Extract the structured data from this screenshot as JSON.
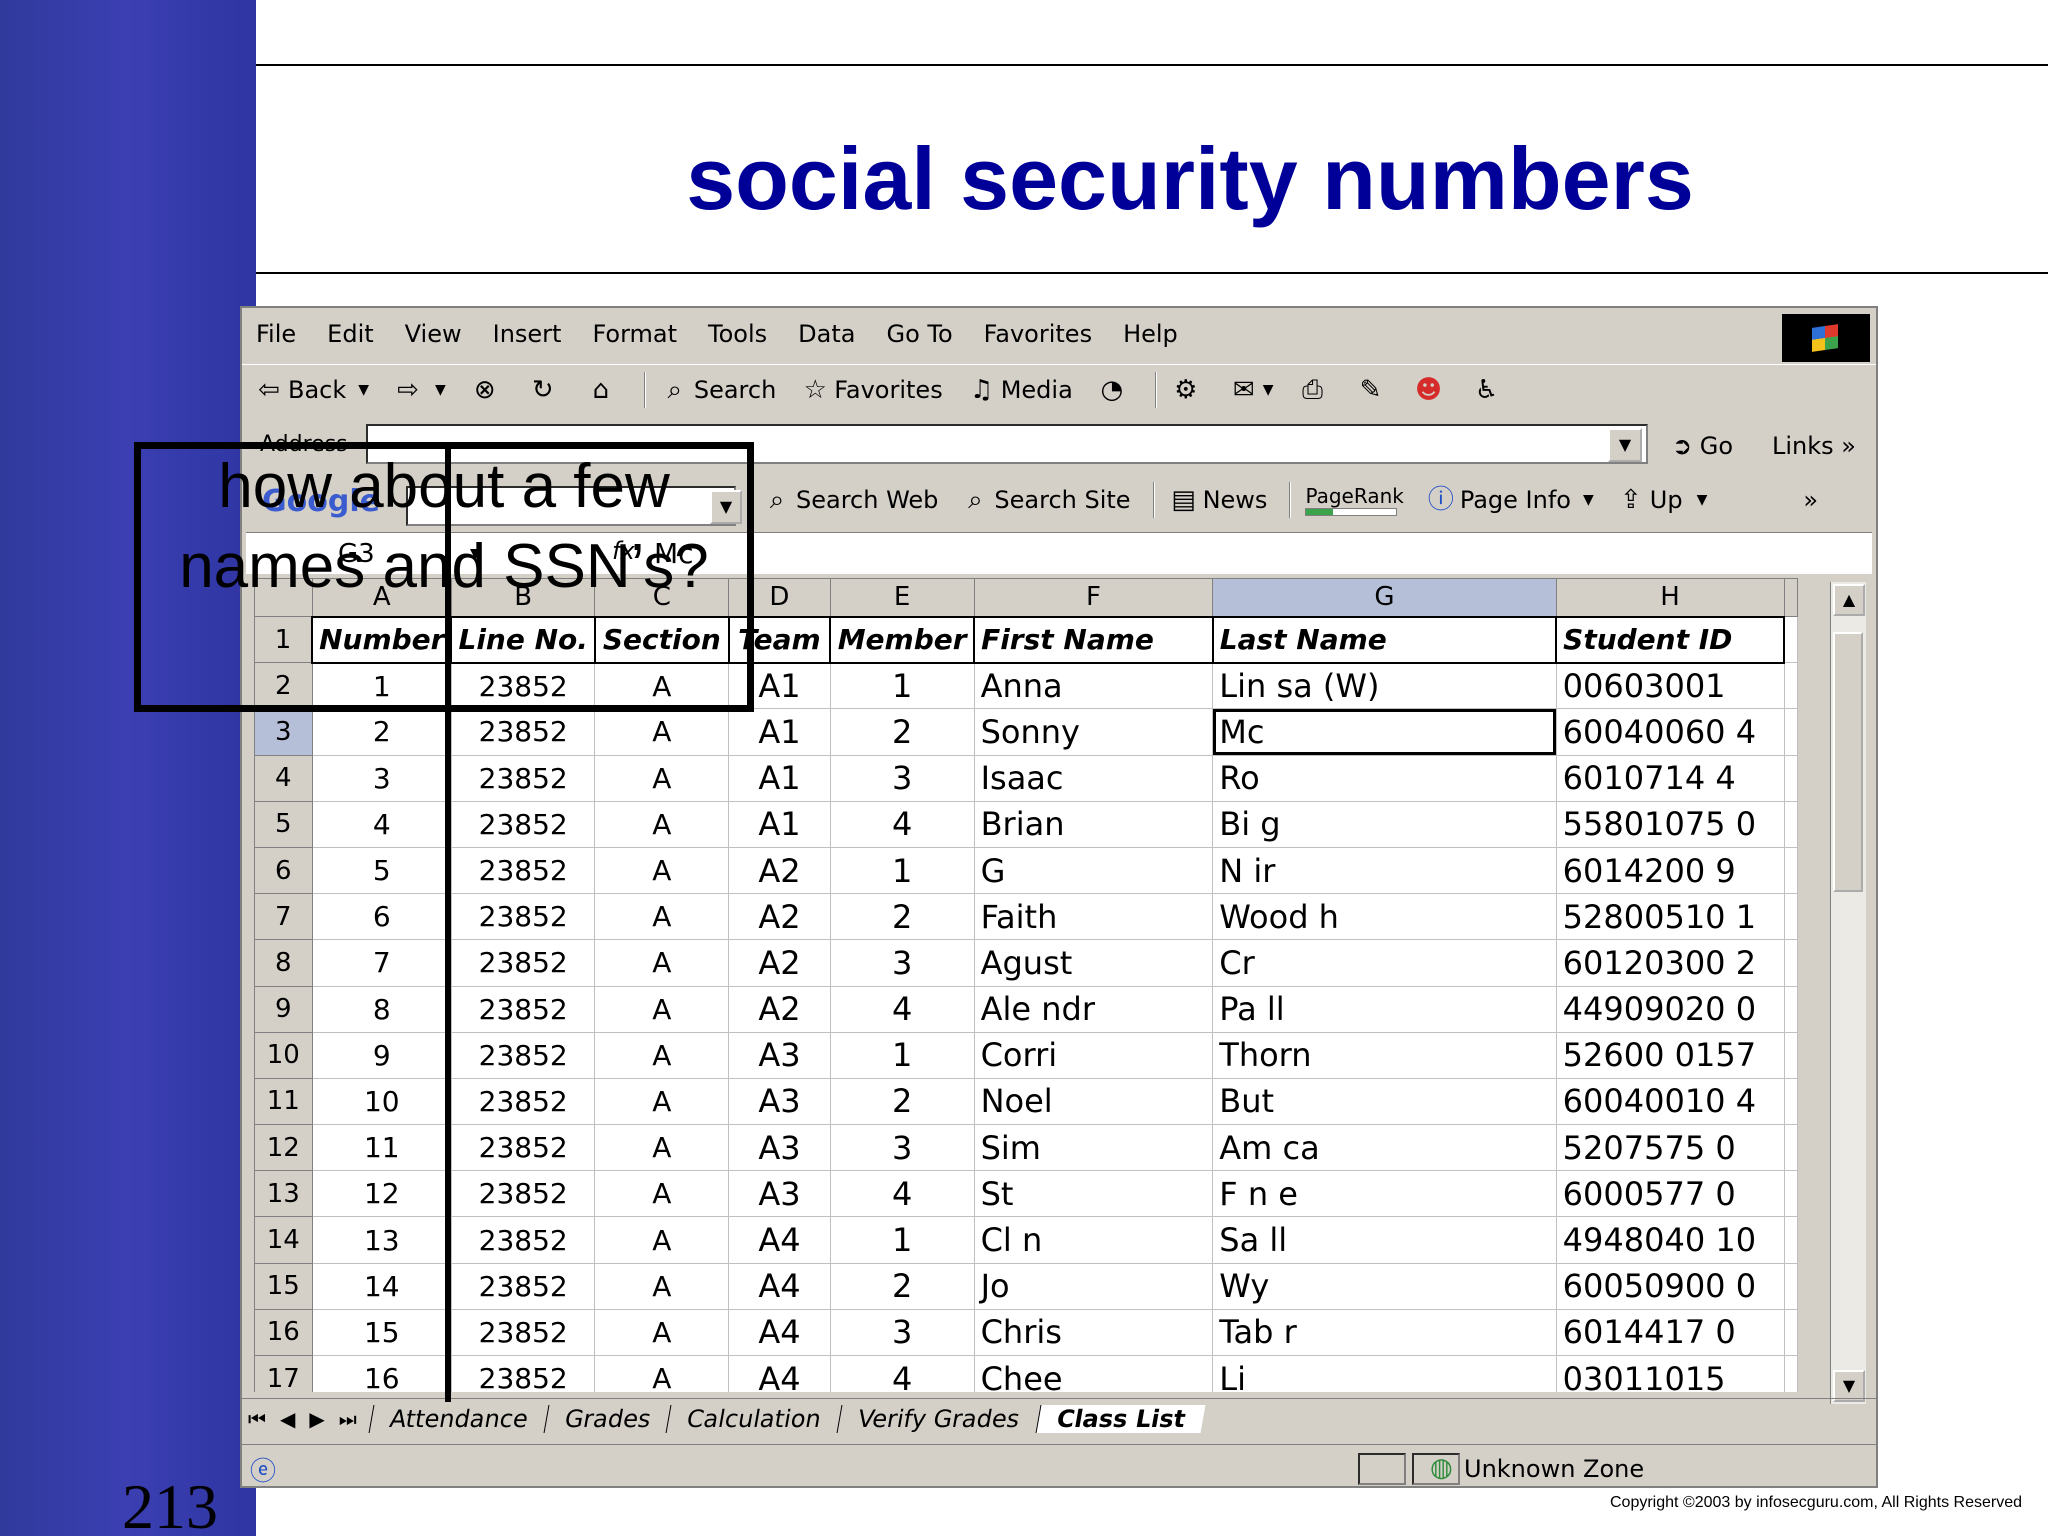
{
  "slide": {
    "title": "social security numbers",
    "number": "213",
    "copyright": "Copyright  ©2003 by infosecguru.com, All Rights Reserved",
    "overlay_text": "how about a few names and SSN’s?"
  },
  "browser": {
    "menu": [
      "File",
      "Edit",
      "View",
      "Insert",
      "Format",
      "Tools",
      "Data",
      "Go To",
      "Favorites",
      "Help"
    ],
    "toolbar": {
      "back": "Back",
      "search": "Search",
      "favorites": "Favorites",
      "media": "Media"
    },
    "address": {
      "label": "Address",
      "value": "",
      "go": "Go",
      "links": "Links"
    },
    "google": {
      "logo": "Google",
      "search_web": "Search Web",
      "search_site": "Search Site",
      "news": "News",
      "pagerank": "PageRank",
      "page_info": "Page Info",
      "up": "Up"
    },
    "status": {
      "zone": "Unknown Zone"
    }
  },
  "sheet": {
    "name_box": "G3",
    "formula_value": "Mc",
    "columns": [
      "A",
      "B",
      "C",
      "D",
      "E",
      "F",
      "G",
      "H"
    ],
    "headers": [
      "Number",
      "Line No.",
      "Section",
      "Team",
      "Member",
      "First Name",
      "Last Name",
      "Student ID"
    ],
    "rows": [
      [
        "1",
        "23852",
        "A",
        "A1",
        "1",
        "Anna",
        "Lin  sa  (W)",
        "00603001"
      ],
      [
        "2",
        "23852",
        "A",
        "A1",
        "2",
        "Sonny",
        "Mc",
        "60040060 4"
      ],
      [
        "3",
        "23852",
        "A",
        "A1",
        "3",
        "Isaac",
        "Ro",
        "6010714 4"
      ],
      [
        "4",
        "23852",
        "A",
        "A1",
        "4",
        "Brian",
        "Bi     g",
        "55801075 0"
      ],
      [
        "5",
        "23852",
        "A",
        "A2",
        "1",
        "G",
        "N  ir",
        "6014200 9"
      ],
      [
        "6",
        "23852",
        "A",
        "A2",
        "2",
        "Faith",
        "Wood        h",
        "52800510 1"
      ],
      [
        "7",
        "23852",
        "A",
        "A2",
        "3",
        "Agust",
        "Cr",
        "60120300 2"
      ],
      [
        "8",
        "23852",
        "A",
        "A2",
        "4",
        "Ale   ndr",
        "Pa    ll",
        "44909020 0"
      ],
      [
        "9",
        "23852",
        "A",
        "A3",
        "1",
        "Corri",
        "Thorn",
        "52600 0157"
      ],
      [
        "10",
        "23852",
        "A",
        "A3",
        "2",
        "Noel",
        "But",
        "60040010 4"
      ],
      [
        "11",
        "23852",
        "A",
        "A3",
        "3",
        "Sim",
        "Am        ca",
        "5207575 0"
      ],
      [
        "12",
        "23852",
        "A",
        "A3",
        "4",
        "St",
        "F       n  e",
        "6000577 0"
      ],
      [
        "13",
        "23852",
        "A",
        "A4",
        "1",
        "Cl        n",
        "Sa    ll",
        "4948040 10"
      ],
      [
        "14",
        "23852",
        "A",
        "A4",
        "2",
        "Jo",
        "Wy",
        "60050900 0"
      ],
      [
        "15",
        "23852",
        "A",
        "A4",
        "3",
        "Chris",
        "Tab  r",
        "6014417 0"
      ],
      [
        "16",
        "23852",
        "A",
        "A4",
        "4",
        "Chee",
        "Li",
        "03011015 "
      ]
    ],
    "tabs": [
      "Attendance",
      "Grades",
      "Calculation",
      "Verify Grades",
      "Class List"
    ],
    "active_tab": "Class List"
  }
}
